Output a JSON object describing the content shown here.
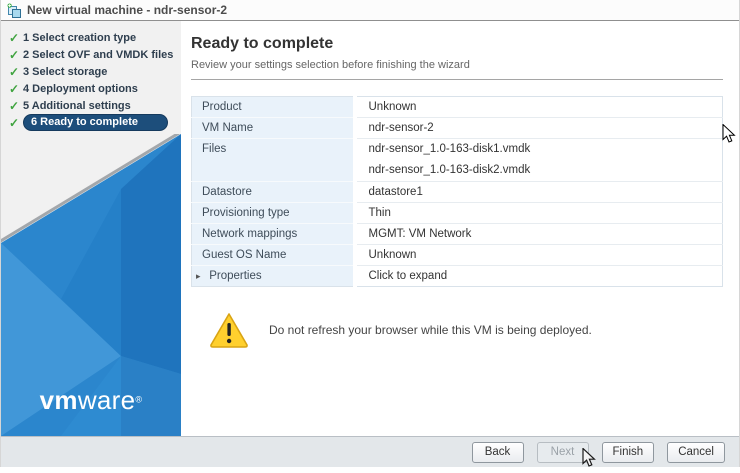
{
  "window": {
    "title": "New virtual machine - ndr-sensor-2"
  },
  "icons": {
    "check": "✓",
    "expander": "▸",
    "new_vm_icon": "new-vm-icon",
    "warning_icon": "warning-triangle-icon"
  },
  "sidebar": {
    "steps": [
      {
        "label": "1 Select creation type",
        "completed": true,
        "active": false
      },
      {
        "label": "2 Select OVF and VMDK files",
        "completed": true,
        "active": false
      },
      {
        "label": "3 Select storage",
        "completed": true,
        "active": false
      },
      {
        "label": "4 Deployment options",
        "completed": true,
        "active": false
      },
      {
        "label": "5 Additional settings",
        "completed": true,
        "active": false
      },
      {
        "label": "6 Ready to complete",
        "completed": true,
        "active": true
      }
    ],
    "brand": {
      "bold": "vm",
      "regular": "ware",
      "reg_mark": "®"
    }
  },
  "main": {
    "title": "Ready to complete",
    "subtitle": "Review your settings selection before finishing the wizard",
    "table": {
      "rows": [
        {
          "label": "Product",
          "values": [
            "Unknown"
          ]
        },
        {
          "label": "VM Name",
          "values": [
            "ndr-sensor-2"
          ]
        },
        {
          "label": "Files",
          "values": [
            "ndr-sensor_1.0-163-disk1.vmdk",
            "ndr-sensor_1.0-163-disk2.vmdk"
          ]
        },
        {
          "label": "Datastore",
          "values": [
            "datastore1"
          ]
        },
        {
          "label": "Provisioning type",
          "values": [
            "Thin"
          ]
        },
        {
          "label": "Network mappings",
          "values": [
            "MGMT: VM Network"
          ]
        },
        {
          "label": "Guest OS Name",
          "values": [
            "Unknown"
          ]
        },
        {
          "label": "Properties",
          "values": [
            "Click to expand"
          ],
          "expandable": true
        }
      ]
    },
    "warning": {
      "text": "Do not refresh your browser while this VM is being deployed."
    }
  },
  "footer": {
    "buttons": {
      "back": "Back",
      "next": "Next",
      "finish": "Finish",
      "cancel": "Cancel"
    },
    "next_disabled": true
  },
  "colors": {
    "active_step_bg": "#1d4e7b",
    "check_green": "#3fa33f",
    "brand_blue": "#2b86cd",
    "label_cell_bg": "#e9f2fa",
    "warning_yellow": "#ffd02e",
    "footer_bg": "#e3e7ea"
  }
}
